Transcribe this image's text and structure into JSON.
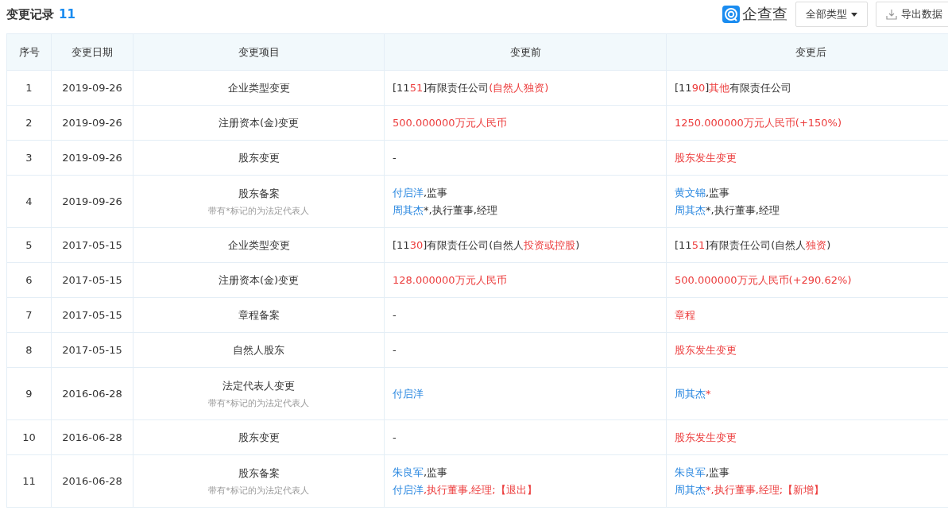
{
  "header": {
    "title": "变更记录",
    "count": "11",
    "logo_text": "企查查",
    "type_filter": "全部类型",
    "export_button": "导出数据"
  },
  "table": {
    "columns": [
      "序号",
      "变更日期",
      "变更项目",
      "变更前",
      "变更后"
    ],
    "rows": [
      {
        "index": "1",
        "date": "2019-09-26",
        "item": "企业类型变更",
        "before": [
          [
            {
              "text": "[11",
              "kind": "plain"
            },
            {
              "text": "51",
              "kind": "changed"
            },
            {
              "text": "]有限责任公司",
              "kind": "plain"
            },
            {
              "text": "(自然人独资)",
              "kind": "changed"
            }
          ]
        ],
        "after": [
          [
            {
              "text": "[11",
              "kind": "plain"
            },
            {
              "text": "90",
              "kind": "changed"
            },
            {
              "text": "]",
              "kind": "plain"
            },
            {
              "text": "其他",
              "kind": "changed"
            },
            {
              "text": "有限责任公司",
              "kind": "plain"
            }
          ]
        ]
      },
      {
        "index": "2",
        "date": "2019-09-26",
        "item": "注册资本(金)变更",
        "before": [
          [
            {
              "text": "500.000000万元人民币",
              "kind": "changed"
            }
          ]
        ],
        "after": [
          [
            {
              "text": "1250.000000万元人民币(+150%)",
              "kind": "changed"
            }
          ]
        ]
      },
      {
        "index": "3",
        "date": "2019-09-26",
        "item": "股东变更",
        "before": [
          [
            {
              "text": "-",
              "kind": "plain"
            }
          ]
        ],
        "after": [
          [
            {
              "text": "股东发生变更",
              "kind": "changed"
            }
          ]
        ]
      },
      {
        "index": "4",
        "date": "2019-09-26",
        "item": "股东备案",
        "note": "带有*标记的为法定代表人",
        "before": [
          [
            {
              "text": "付启洋",
              "kind": "person"
            },
            {
              "text": ",监事",
              "kind": "plain"
            }
          ],
          [
            {
              "text": "周其杰",
              "kind": "person"
            },
            {
              "text": "*,执行董事,经理",
              "kind": "plain"
            }
          ]
        ],
        "after": [
          [
            {
              "text": "黄文锦",
              "kind": "person"
            },
            {
              "text": ",监事",
              "kind": "plain"
            }
          ],
          [
            {
              "text": "周其杰",
              "kind": "person"
            },
            {
              "text": "*,执行董事,经理",
              "kind": "plain"
            }
          ]
        ]
      },
      {
        "index": "5",
        "date": "2017-05-15",
        "item": "企业类型变更",
        "before": [
          [
            {
              "text": "[11",
              "kind": "plain"
            },
            {
              "text": "30",
              "kind": "changed"
            },
            {
              "text": "]有限责任公司(自然人",
              "kind": "plain"
            },
            {
              "text": "投资或控股",
              "kind": "changed"
            },
            {
              "text": ")",
              "kind": "plain"
            }
          ]
        ],
        "after": [
          [
            {
              "text": "[11",
              "kind": "plain"
            },
            {
              "text": "51",
              "kind": "changed"
            },
            {
              "text": "]有限责任公司(自然人",
              "kind": "plain"
            },
            {
              "text": "独资",
              "kind": "changed"
            },
            {
              "text": ")",
              "kind": "plain"
            }
          ]
        ]
      },
      {
        "index": "6",
        "date": "2017-05-15",
        "item": "注册资本(金)变更",
        "before": [
          [
            {
              "text": "128.000000万元人民币",
              "kind": "changed"
            }
          ]
        ],
        "after": [
          [
            {
              "text": "500.000000万元人民币(+290.62%)",
              "kind": "changed"
            }
          ]
        ]
      },
      {
        "index": "7",
        "date": "2017-05-15",
        "item": "章程备案",
        "before": [
          [
            {
              "text": "-",
              "kind": "plain"
            }
          ]
        ],
        "after": [
          [
            {
              "text": "章程",
              "kind": "changed"
            }
          ]
        ]
      },
      {
        "index": "8",
        "date": "2017-05-15",
        "item": "自然人股东",
        "before": [
          [
            {
              "text": "-",
              "kind": "plain"
            }
          ]
        ],
        "after": [
          [
            {
              "text": "股东发生变更",
              "kind": "changed"
            }
          ]
        ]
      },
      {
        "index": "9",
        "date": "2016-06-28",
        "item": "法定代表人变更",
        "note": "带有*标记的为法定代表人",
        "before": [
          [
            {
              "text": "付启洋",
              "kind": "person"
            }
          ]
        ],
        "after": [
          [
            {
              "text": "周其杰",
              "kind": "person"
            },
            {
              "text": "*",
              "kind": "changed"
            }
          ]
        ]
      },
      {
        "index": "10",
        "date": "2016-06-28",
        "item": "股东变更",
        "before": [
          [
            {
              "text": "-",
              "kind": "plain"
            }
          ]
        ],
        "after": [
          [
            {
              "text": "股东发生变更",
              "kind": "changed"
            }
          ]
        ]
      },
      {
        "index": "11",
        "date": "2016-06-28",
        "item": "股东备案",
        "note": "带有*标记的为法定代表人",
        "before": [
          [
            {
              "text": "朱良军",
              "kind": "person"
            },
            {
              "text": ",监事",
              "kind": "plain"
            }
          ],
          [
            {
              "text": "付启洋",
              "kind": "person"
            },
            {
              "text": ",执行董事,经理;【退出】",
              "kind": "changed"
            }
          ]
        ],
        "after": [
          [
            {
              "text": "朱良军",
              "kind": "person"
            },
            {
              "text": ",监事",
              "kind": "plain"
            }
          ],
          [
            {
              "text": "周其杰",
              "kind": "person"
            },
            {
              "text": "*,执行董事,经理;【新增】",
              "kind": "changed"
            }
          ]
        ]
      }
    ]
  }
}
